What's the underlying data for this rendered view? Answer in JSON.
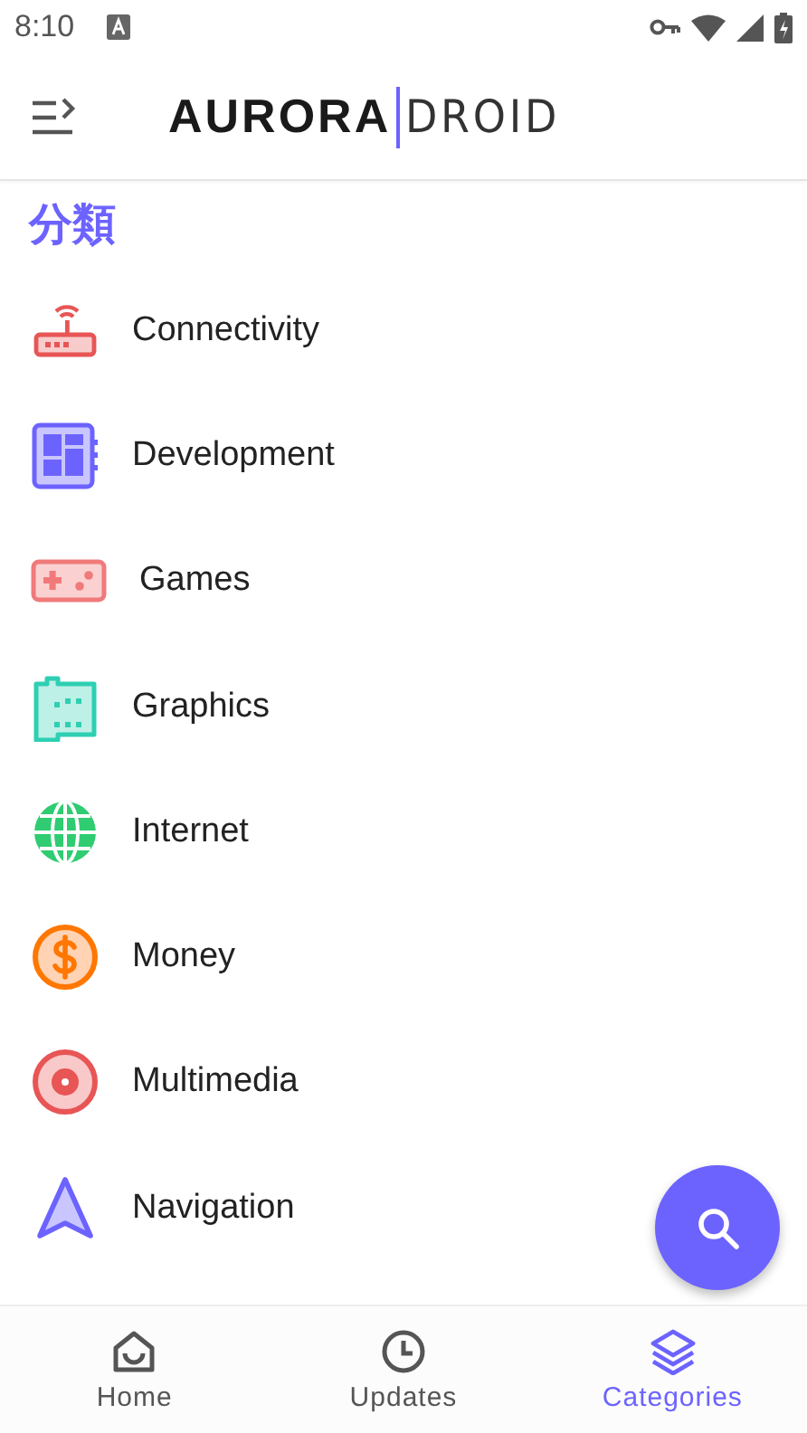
{
  "status_bar": {
    "time": "8:10"
  },
  "app_bar": {
    "logo_bold": "AURORA",
    "logo_light": "DROID"
  },
  "heading": "分類",
  "categories": [
    {
      "label": "Connectivity"
    },
    {
      "label": "Development"
    },
    {
      "label": "Games"
    },
    {
      "label": "Graphics"
    },
    {
      "label": "Internet"
    },
    {
      "label": "Money"
    },
    {
      "label": "Multimedia"
    },
    {
      "label": "Navigation"
    }
  ],
  "bottom_nav": [
    {
      "label": "Home",
      "selected": false
    },
    {
      "label": "Updates",
      "selected": false
    },
    {
      "label": "Categories",
      "selected": true
    }
  ]
}
